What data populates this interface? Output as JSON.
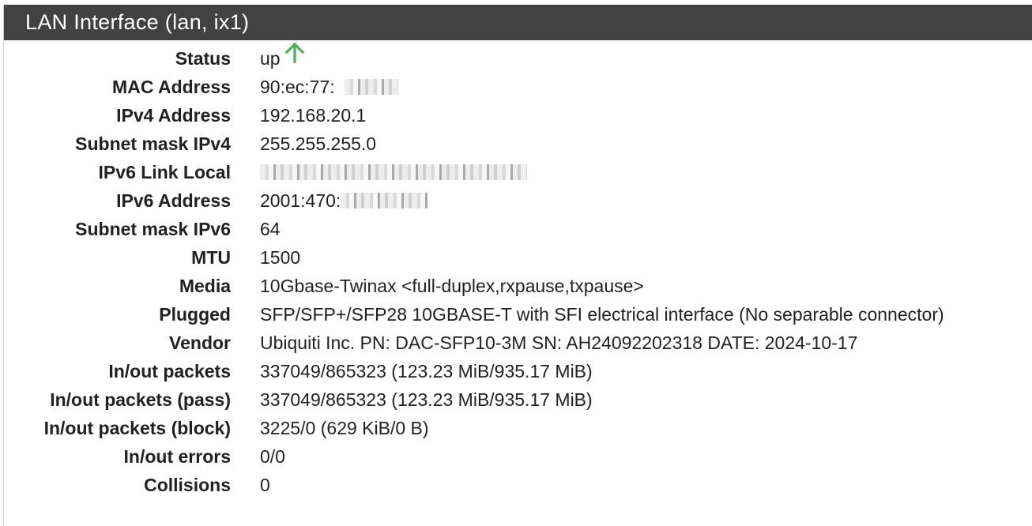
{
  "panel": {
    "title": "LAN Interface (lan, ix1)"
  },
  "status_arrow_color": "#4caf50",
  "rows": [
    {
      "label": "Status",
      "value": "up"
    },
    {
      "label": "MAC Address",
      "value": "90:ec:77:"
    },
    {
      "label": "IPv4 Address",
      "value": "192.168.20.1"
    },
    {
      "label": "Subnet mask IPv4",
      "value": "255.255.255.0"
    },
    {
      "label": "IPv6 Link Local",
      "value": ""
    },
    {
      "label": "IPv6 Address",
      "value": "2001:470:"
    },
    {
      "label": "Subnet mask IPv6",
      "value": "64"
    },
    {
      "label": "MTU",
      "value": "1500"
    },
    {
      "label": "Media",
      "value": "10Gbase-Twinax <full-duplex,rxpause,txpause>"
    },
    {
      "label": "Plugged",
      "value": "SFP/SFP+/SFP28 10GBASE-T with SFI electrical interface (No separable connector)"
    },
    {
      "label": "Vendor",
      "value": "Ubiquiti Inc. PN: DAC-SFP10-3M SN: AH24092202318 DATE: 2024-10-17"
    },
    {
      "label": "In/out packets",
      "value": "337049/865323 (123.23 MiB/935.17 MiB)"
    },
    {
      "label": "In/out packets (pass)",
      "value": "337049/865323 (123.23 MiB/935.17 MiB)"
    },
    {
      "label": "In/out packets (block)",
      "value": "3225/0 (629 KiB/0 B)"
    },
    {
      "label": "In/out errors",
      "value": "0/0"
    },
    {
      "label": "Collisions",
      "value": "0"
    }
  ]
}
